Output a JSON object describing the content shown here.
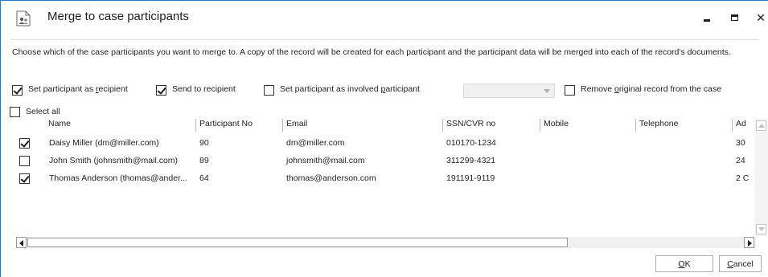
{
  "window": {
    "title": "Merge to case participants",
    "icon": "participants-merge-icon",
    "accent_color": "#2b78c5"
  },
  "description": "Choose which of the case participants you want to merge to. A copy of the record will be created for each participant and the participant data will be merged into each of the record's documents.",
  "options": {
    "set_recipient": {
      "label_pre": "Set participant as ",
      "label_key": "r",
      "label_post": "ecipient",
      "checked": true
    },
    "send_to_recipient": {
      "label": "Send to recipient",
      "checked": true
    },
    "set_involved": {
      "label_pre": "Set participant as involved ",
      "label_key": "p",
      "label_post": "articipant",
      "checked": false
    },
    "involved_dropdown": {
      "value": "",
      "disabled": true
    },
    "remove_original": {
      "label_pre": "Remove ",
      "label_key": "o",
      "label_post": "riginal record from the case",
      "checked": false
    },
    "select_all": {
      "label": "Select all",
      "checked": false
    }
  },
  "table": {
    "columns": [
      "Name",
      "Participant No",
      "Email",
      "SSN/CVR no",
      "Mobile",
      "Telephone",
      "Ad"
    ],
    "rows": [
      {
        "checked": true,
        "cells": [
          "Daisy Miller (dm@miller.com)",
          "90",
          "dm@miller.com",
          "010170-1234",
          "",
          "",
          "30"
        ]
      },
      {
        "checked": false,
        "cells": [
          "John Smith (johnsmith@mail.com)",
          "89",
          "johnsmith@mail.com",
          "311299-4321",
          "",
          "",
          "24"
        ]
      },
      {
        "checked": true,
        "cells": [
          "Thomas Anderson (thomas@ander...",
          "64",
          "thomas@anderson.com",
          "191191-9119",
          "",
          "",
          "2 C"
        ]
      }
    ]
  },
  "buttons": {
    "ok": {
      "key": "O",
      "rest": "K"
    },
    "cancel": {
      "key": "C",
      "rest": "ancel"
    }
  }
}
